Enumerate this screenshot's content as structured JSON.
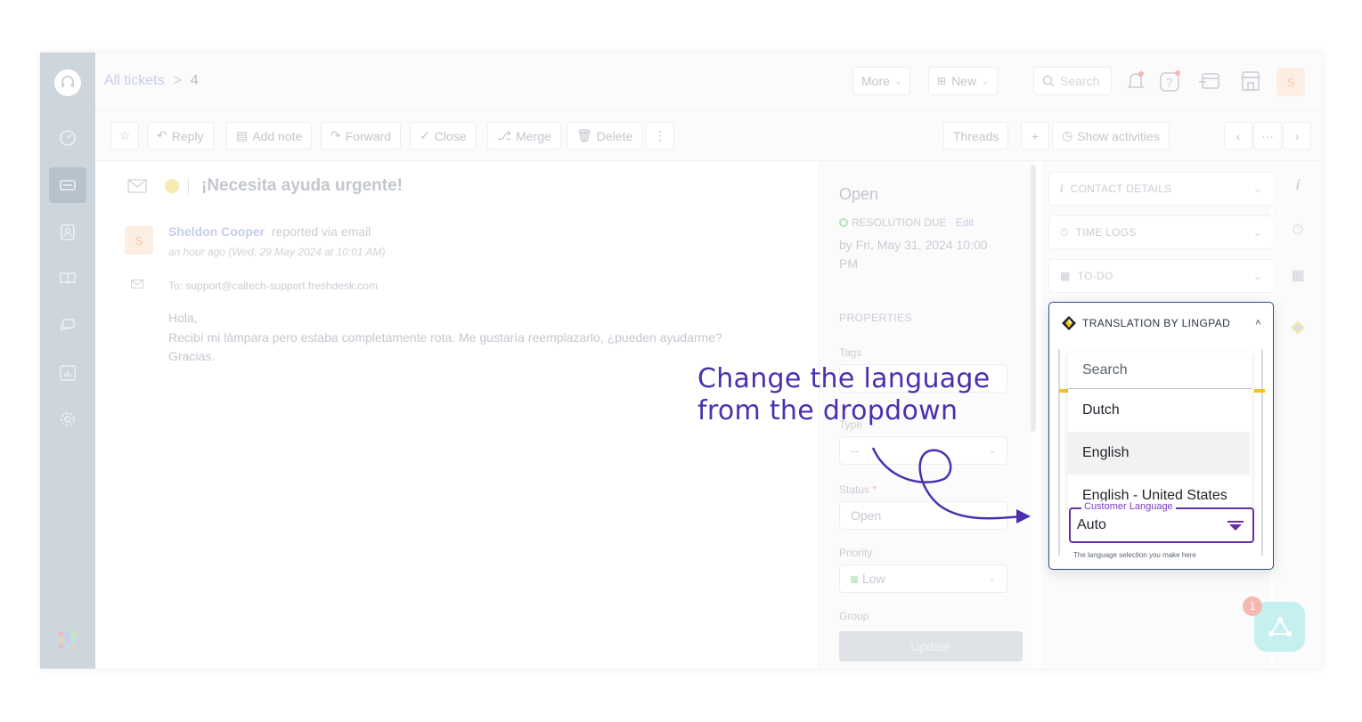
{
  "breadcrumb": {
    "parent": "All tickets",
    "separator": ">",
    "current": "4"
  },
  "topbar": {
    "more_label": "More",
    "new_label": "New",
    "search_placeholder": "Search",
    "avatar_initial": "S"
  },
  "toolbar": {
    "reply": "Reply",
    "add_note": "Add note",
    "forward": "Forward",
    "close": "Close",
    "merge": "Merge",
    "delete": "Delete",
    "more": "⋮",
    "threads": "Threads",
    "plus": "+",
    "show_activities": "Show activities",
    "nav_ellipsis": "···"
  },
  "ticket": {
    "subject": "¡Necesita ayuda urgente!",
    "requester_initial": "S",
    "requester_name": "Sheldon Cooper",
    "reported_via": "reported via email",
    "timestamp": "an hour ago (Wed, 29 May 2024 at 10:01 AM)",
    "to_line": "To: support@caltech-support.freshdesk.com",
    "body": [
      "Hola,",
      "Recibí mi lámpara pero estaba completamente rota. Me gustaría reemplazarlo, ¿pueden ayudarme?",
      "Gracias."
    ]
  },
  "properties": {
    "status_title": "Open",
    "resolution_label": "RESOLUTION DUE",
    "edit_label": "Edit",
    "due_date": "by Fri, May 31, 2024 10:00 PM",
    "section_title": "PROPERTIES",
    "tags_label": "Tags",
    "type_label": "Type",
    "type_value": "--",
    "status_label": "Status",
    "required_mark": "*",
    "status_value": "Open",
    "priority_label": "Priority",
    "priority_value": "Low",
    "group_label": "Group",
    "update_button": "Update"
  },
  "right_panel": {
    "contact_details": "CONTACT DETAILS",
    "time_logs": "TIME LOGS",
    "todo": "TO-DO",
    "chat_badge_count": "1"
  },
  "lingpad": {
    "title": "TRANSLATION BY LINGPAD",
    "search_placeholder": "Search",
    "options": [
      "Dutch",
      "English",
      "English - United States"
    ],
    "highlighted_option": "English",
    "select_legend": "Customer Language",
    "select_value": "Auto",
    "note": "The language selection you make here"
  },
  "annotation": {
    "line1": "Change the language",
    "line2": "from the dropdown"
  },
  "colors": {
    "annotation": "#4b2fb0",
    "select_border": "#6b2ca8",
    "sidebar": "#cdd5dd",
    "lingpad_border": "#2e4a8a",
    "accent_yellow": "#f4c21e"
  }
}
